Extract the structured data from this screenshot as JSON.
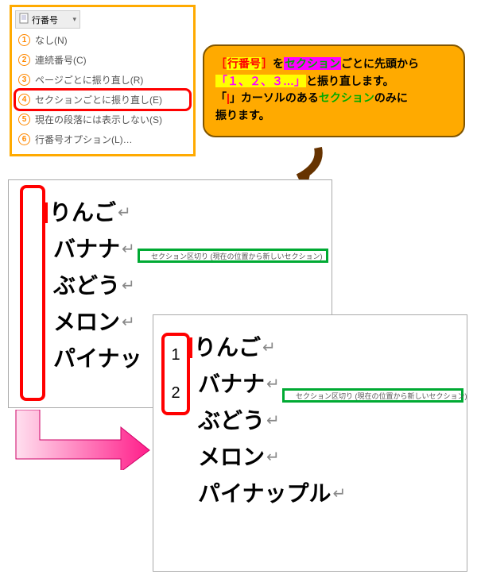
{
  "menu": {
    "title": "行番号",
    "items": [
      {
        "num": "1",
        "label": "なし(N)"
      },
      {
        "num": "2",
        "label": "連続番号(C)"
      },
      {
        "num": "3",
        "label": "ページごとに振り直し(R)"
      },
      {
        "num": "4",
        "label": "セクションごとに振り直し(E)",
        "selected": true
      },
      {
        "num": "5",
        "label": "現在の段落には表示しない(S)"
      },
      {
        "num": "6",
        "label": "行番号オプション(L)…"
      }
    ]
  },
  "callout": {
    "p1a": "［",
    "label": "行番号",
    "p1b": "］",
    "p1c": "を",
    "section_word": "セクション",
    "p1d": "ごとに先頭から",
    "numbers": "「１、２、３…」",
    "p2": "と振り直します。",
    "p3a": "「",
    "cursor": "|",
    "p3b": "」カーソルのある",
    "section_word2": "セクション",
    "p3c": "のみに",
    "p4": "振ります。"
  },
  "section_break_text": "セクション区切り (現在の位置から新しいセクション)",
  "doc_lines": [
    "りんご",
    "バナナ",
    "ぶどう",
    "メロン",
    "パイナップル"
  ],
  "doc_lines_before_trunc": [
    "りんご",
    "バナナ",
    "ぶどう",
    "メロン",
    "パイナッ"
  ],
  "line_numbers_after": [
    "1",
    "2"
  ],
  "ret": "↵"
}
